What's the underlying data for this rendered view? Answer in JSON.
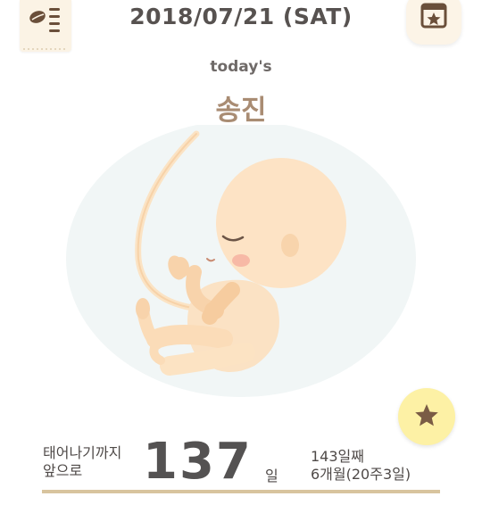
{
  "header": {
    "date": "2018/07/21 (SAT)"
  },
  "main": {
    "subtitle": "today's",
    "baby_name": "송진"
  },
  "countdown": {
    "label_line1": "태어나기까지",
    "label_line2": "앞으로",
    "days_remaining": "137",
    "days_unit": "일",
    "day_number": "143일째",
    "month_week": "6개월(20주3일)"
  },
  "icons": {
    "memo": "memo-list-icon",
    "calendar": "calendar-star-icon",
    "favorite": "star-icon"
  },
  "colors": {
    "accent_brown": "#a98c73",
    "divider": "#d8c49e",
    "favorite_bg": "#fdf1a5",
    "card_bg": "#fcf4e7"
  }
}
